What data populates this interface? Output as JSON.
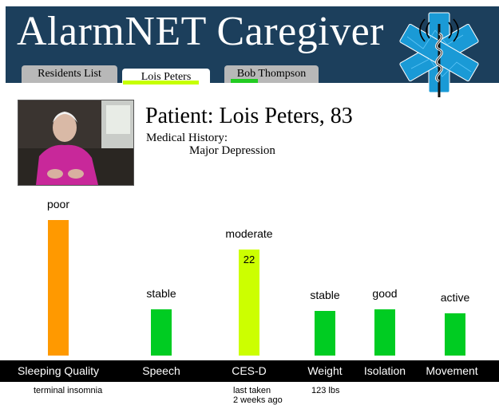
{
  "app": {
    "title": "AlarmNET Caregiver"
  },
  "tabs": [
    {
      "label": "Residents List",
      "active": false
    },
    {
      "label": "Lois Peters",
      "active": true,
      "underline_color": "#c6ff00"
    },
    {
      "label": "Bob Thompson",
      "active": false,
      "underline_color": "#22cc22"
    }
  ],
  "patient": {
    "heading": "Patient: Lois Peters, 83",
    "history_label": "Medical History:",
    "history_value": "Major Depression"
  },
  "colors": {
    "header": "#1c3f5c",
    "orange": "#ff9900",
    "green": "#00cc22",
    "lime": "#ccff00"
  },
  "metrics": [
    {
      "label": "Sleeping Quality",
      "status": "poor",
      "level": 1.0,
      "color": "#ff9900",
      "note": "terminal insomnia"
    },
    {
      "label": "Speech",
      "status": "stable",
      "level": 0.34,
      "color": "#00cc22",
      "note": ""
    },
    {
      "label": "CES-D",
      "status": "moderate",
      "level": 0.78,
      "color": "#ccff00",
      "value": "22",
      "note": "last taken\n2 weeks ago"
    },
    {
      "label": "Weight",
      "status": "stable",
      "level": 0.33,
      "color": "#00cc22",
      "note": "123 lbs"
    },
    {
      "label": "Isolation",
      "status": "good",
      "level": 0.34,
      "color": "#00cc22",
      "note": ""
    },
    {
      "label": "Movement",
      "status": "active",
      "level": 0.31,
      "color": "#00cc22",
      "note": ""
    }
  ]
}
